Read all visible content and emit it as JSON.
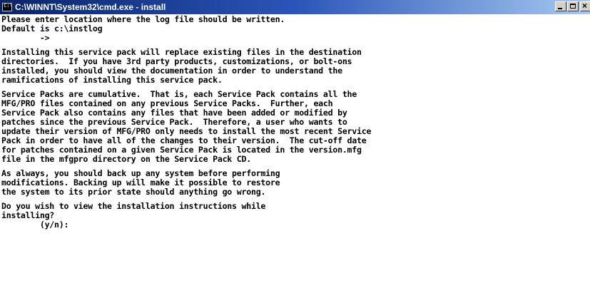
{
  "window": {
    "title": "C:\\WINNT\\System32\\cmd.exe - install"
  },
  "console": {
    "lines": [
      "Please enter location where the log file should be written.",
      "Default is c:\\instlog",
      "        ->",
      "",
      "Installing this service pack will replace existing files in the destination",
      "directories.  If you have 3rd party products, customizations, or bolt-ons",
      "installed, you should view the documentation in order to understand the",
      "ramifications of installing this service pack.",
      "",
      "Service Packs are cumulative.  That is, each Service Pack contains all the",
      "MFG/PRO files contained on any previous Service Packs.  Further, each",
      "Service Pack also contains any files that have been added or modified by",
      "patches since the previous Service Pack.  Therefore, a user who wants to",
      "update their version of MFG/PRO only needs to install the most recent Service",
      "Pack in order to have all of the changes to their version.  The cut-off date",
      "for patches contained on a given Service Pack is located in the version.mfg",
      "file in the mfgpro directory on the Service Pack CD.",
      "",
      "As always, you should back up any system before performing",
      "modifications. Backing up will make it possible to restore",
      "the system to its prior state should anything go wrong.",
      "",
      "Do you wish to view the installation instructions while",
      "installing?",
      "        (y/n):"
    ]
  }
}
